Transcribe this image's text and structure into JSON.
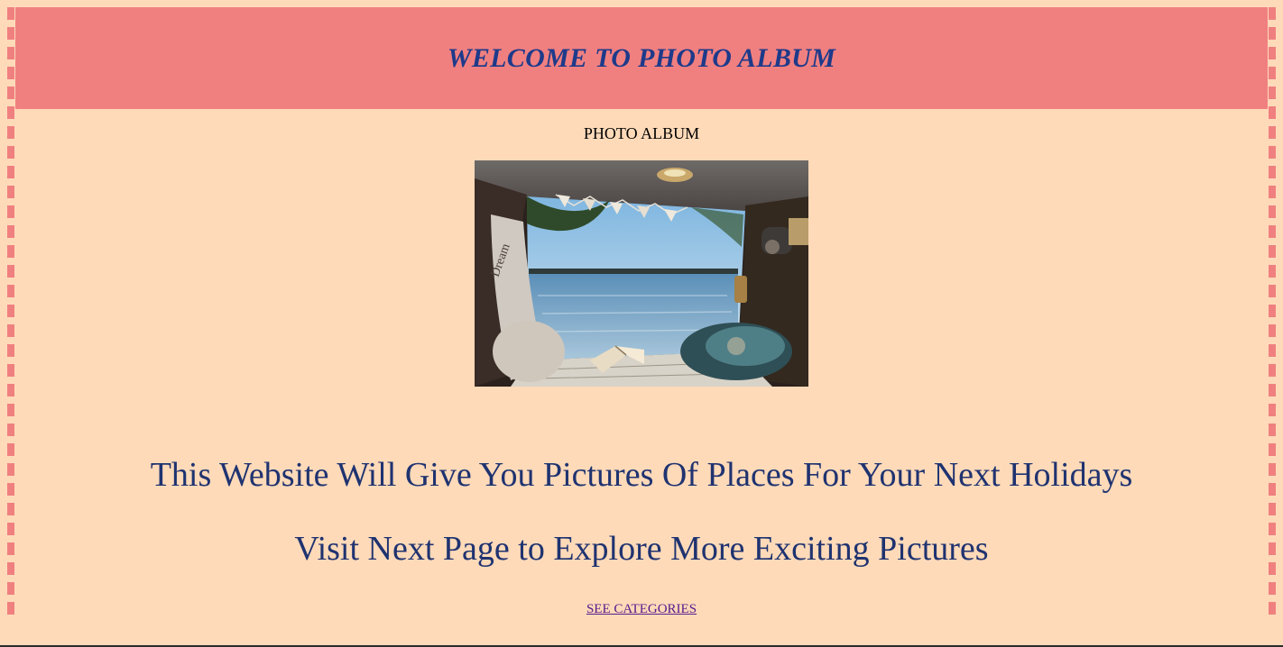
{
  "header": {
    "title": "WELCOME TO PHOTO ALBUM"
  },
  "album": {
    "label": "PHOTO ALBUM",
    "photo_subject": "view of a lake from inside a camper van"
  },
  "content": {
    "line1": "This Website Will Give You Pictures Of Places For Your Next Holidays",
    "line2": "Visit Next Page to Explore More Exciting Pictures"
  },
  "link": {
    "label": "SEE CATEGORIES"
  },
  "colors": {
    "page_background": "#ffdab9",
    "header_background": "#f08080",
    "heading_text": "#1e3a8a",
    "body_text": "#1f3370",
    "link": "#551a8b"
  }
}
